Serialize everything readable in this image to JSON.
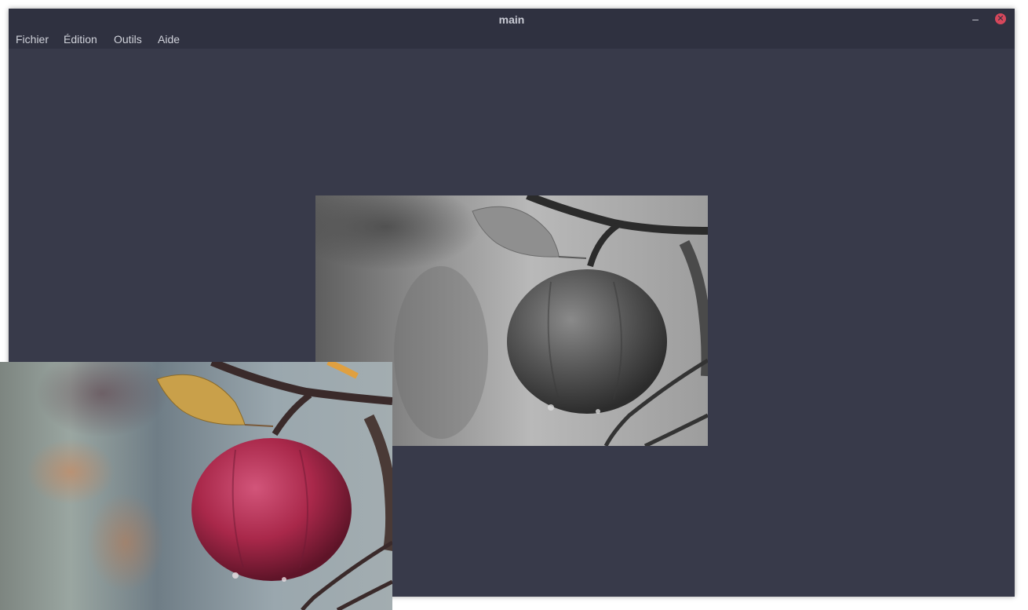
{
  "window": {
    "title": "main",
    "minimize_glyph": "–",
    "close_glyph": "✕"
  },
  "menu": {
    "items": [
      "Fichier",
      "Édition",
      "Outils",
      "Aide"
    ]
  },
  "images": {
    "grayscale_name": "apple-grayscale-image",
    "color_name": "apple-color-image"
  },
  "colors": {
    "window_bg": "#383a4a",
    "titlebar_bg": "#2f3140",
    "close_button": "#d6475b"
  }
}
